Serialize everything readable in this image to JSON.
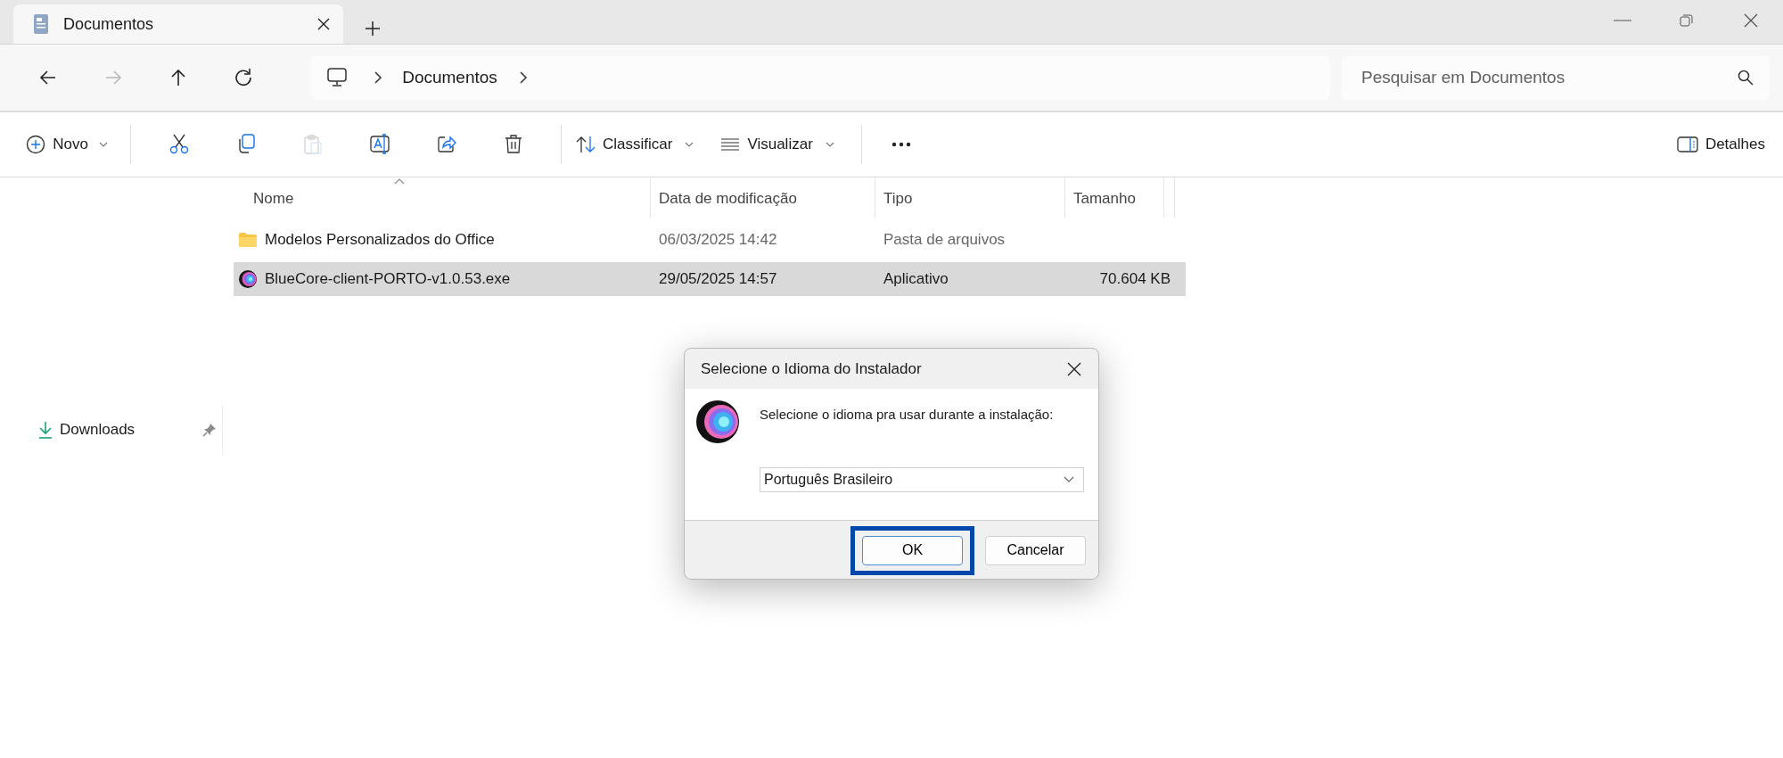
{
  "tabs": [
    {
      "title": "Documentos",
      "selected": true
    }
  ],
  "navigation": [
    {
      "kind": "back",
      "disabled": false
    },
    {
      "kind": "forward",
      "disabled": true
    },
    {
      "kind": "up",
      "disabled": false
    },
    {
      "kind": "refresh",
      "disabled": false
    }
  ],
  "address_bar": {
    "crumbs": [
      "Documentos"
    ]
  },
  "search": {
    "placeholder": "Pesquisar em Documentos"
  },
  "toolbar": {
    "new_label": "Novo",
    "actions": [
      {
        "kind": "cut",
        "disabled": false
      },
      {
        "kind": "copy",
        "disabled": false
      },
      {
        "kind": "paste",
        "disabled": true
      },
      {
        "kind": "rename",
        "disabled": false
      },
      {
        "kind": "share",
        "disabled": false
      },
      {
        "kind": "delete",
        "disabled": false
      }
    ],
    "sort_label": "Classificar",
    "view_label": "Visualizar",
    "details_label": "Detalhes"
  },
  "sidebar": {
    "items": [
      {
        "label": "Downloads",
        "pinned": true
      }
    ]
  },
  "table": {
    "columns": [
      "Nome",
      "Data de modificação",
      "Tipo",
      "Tamanho"
    ],
    "rows": [
      {
        "kind": "folder",
        "name": "Modelos Personalizados do Office",
        "modified": "06/03/2025 14:42",
        "type": "Pasta de arquivos",
        "size": "",
        "selected": false
      },
      {
        "kind": "app",
        "name": "BlueCore-client-PORTO-v1.0.53.exe",
        "modified": "29/05/2025 14:57",
        "type": "Aplicativo",
        "size": "70.604 KB",
        "selected": true
      }
    ]
  },
  "dialog": {
    "title": "Selecione o Idioma do Instalador",
    "message": "Selecione o idioma pra usar durante a instalação:",
    "language": "Português Brasileiro",
    "buttons": [
      {
        "label": "OK",
        "highlighted": true
      },
      {
        "label": "Cancelar",
        "highlighted": false
      }
    ]
  }
}
